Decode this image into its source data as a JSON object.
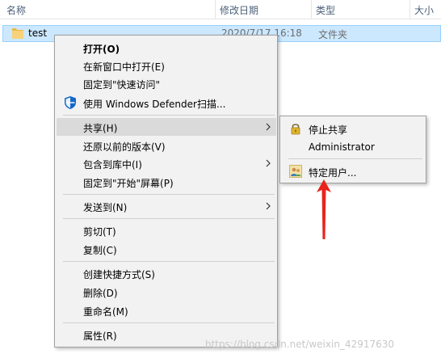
{
  "header": {
    "columns": [
      "名称",
      "修改日期",
      "类型",
      "大小"
    ]
  },
  "file_row": {
    "name": "test",
    "date": "2020/7/17 16:18",
    "type": "文件夹",
    "icon": "folder-icon"
  },
  "context_menu": {
    "items": [
      {
        "label": "打开(O)",
        "bold": true
      },
      {
        "label": "在新窗口中打开(E)"
      },
      {
        "label": "固定到\"快速访问\""
      },
      {
        "label": "使用 Windows Defender扫描...",
        "icon": "windows-defender-shield-icon"
      },
      {
        "label": "共享(H)",
        "submenu": true,
        "highlighted": true
      },
      {
        "label": "还原以前的版本(V)"
      },
      {
        "label": "包含到库中(I)",
        "submenu": true
      },
      {
        "label": "固定到\"开始\"屏幕(P)"
      },
      {
        "label": "发送到(N)",
        "submenu": true
      },
      {
        "label": "剪切(T)"
      },
      {
        "label": "复制(C)"
      },
      {
        "label": "创建快捷方式(S)"
      },
      {
        "label": "删除(D)"
      },
      {
        "label": "重命名(M)"
      },
      {
        "label": "属性(R)"
      }
    ]
  },
  "share_submenu": {
    "items": [
      {
        "label": "停止共享",
        "icon": "lock-icon"
      },
      {
        "label": "Administrator"
      },
      {
        "label": "特定用户...",
        "icon": "users-icon"
      }
    ]
  },
  "watermark": "https://blog.csdn.net/weixin_42917630",
  "colors": {
    "selection": "#cce8ff",
    "menu_bg": "#f2f2f2",
    "menu_highlight": "#dadada",
    "annotation_arrow": "#e8241c"
  }
}
